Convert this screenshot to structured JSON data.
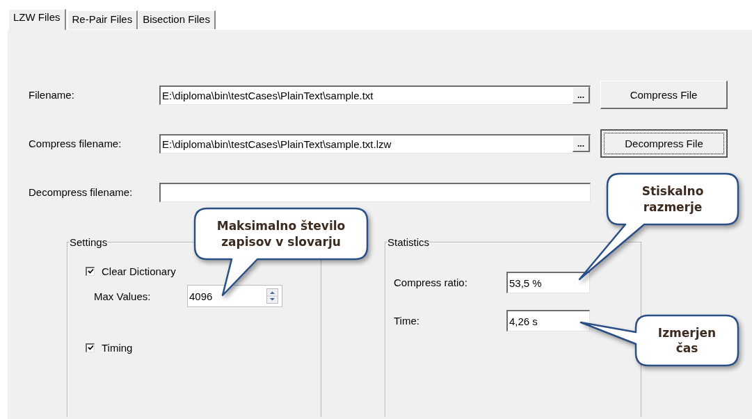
{
  "tabs": [
    {
      "label": "LZW Files",
      "selected": true
    },
    {
      "label": "Re-Pair Files",
      "selected": false
    },
    {
      "label": "Bisection Files",
      "selected": false
    }
  ],
  "file_rows": [
    {
      "label": "Filename:",
      "value": "E:\\diploma\\bin\\testCases\\PlainText\\sample.txt",
      "browse": "...",
      "button": {
        "label": "Compress File",
        "focused": false
      }
    },
    {
      "label": "Compress filename:",
      "value": "E:\\diploma\\bin\\testCases\\PlainText\\sample.txt.lzw",
      "browse": "...",
      "button": {
        "label": "Decompress File",
        "focused": true
      }
    },
    {
      "label": "Decompress filename:",
      "value": ""
    }
  ],
  "settings": {
    "title": "Settings",
    "items": [
      {
        "kind": "checkbox",
        "label": "Clear Dictionary",
        "checked": true
      },
      {
        "kind": "spinner",
        "label": "Max Values:",
        "value": "4096"
      },
      {
        "kind": "checkbox",
        "label": "Timing",
        "checked": true
      }
    ]
  },
  "statistics": {
    "title": "Statistics",
    "items": [
      {
        "label": "Compress ratio:",
        "value": "53,5 %"
      },
      {
        "label": "Time:",
        "value": "4,26 s"
      }
    ]
  },
  "callouts": [
    {
      "text": "Maksimalno število zapisov v slovarju"
    },
    {
      "text": "Stiskalno razmerje"
    },
    {
      "text": "Izmerjen čas"
    }
  ]
}
